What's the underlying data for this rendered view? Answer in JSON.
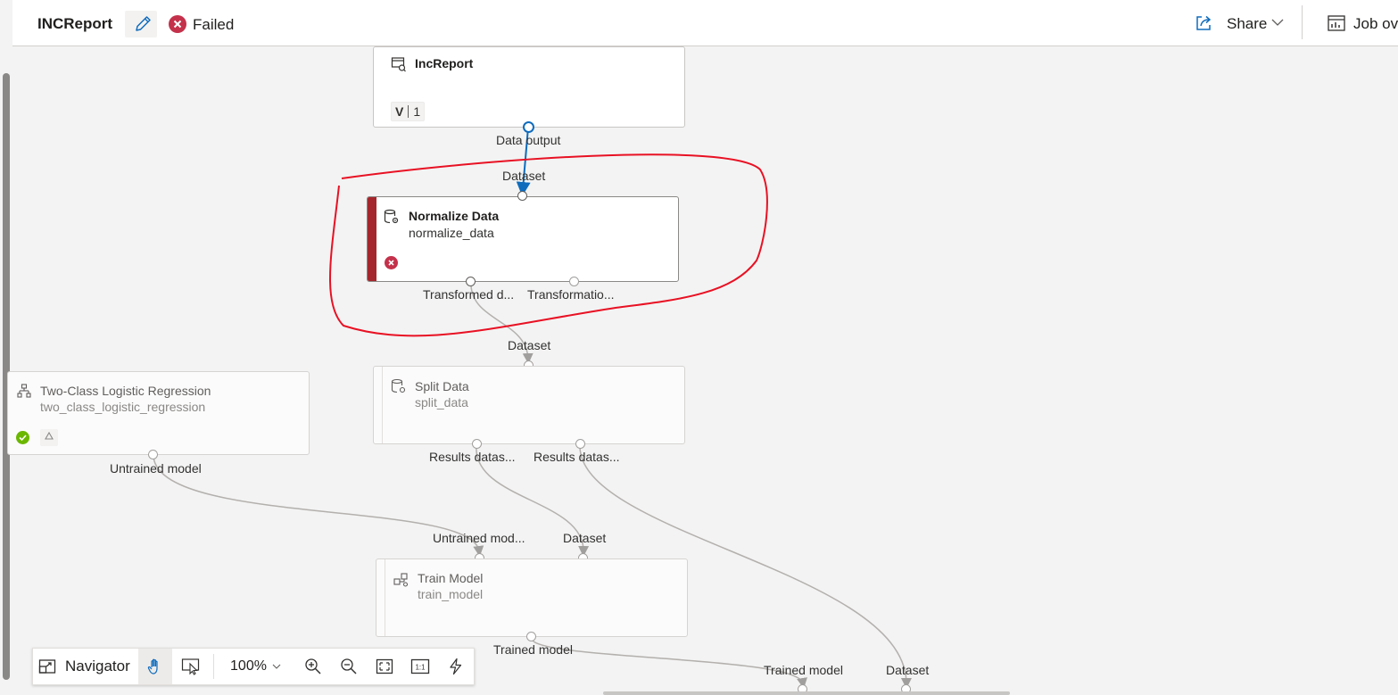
{
  "header": {
    "pipeline_name": "INCReport",
    "status": "Failed",
    "share_label": "Share",
    "job_overview_label": "Job ov"
  },
  "nodes": {
    "inc_report": {
      "title": "IncReport",
      "version_prefix": "V",
      "version": "1",
      "output": "Data output"
    },
    "normalize": {
      "input": "Dataset",
      "title": "Normalize Data",
      "subtitle": "normalize_data",
      "output1": "Transformed d...",
      "output2": "Transformatio..."
    },
    "logistic": {
      "title": "Two-Class Logistic Regression",
      "subtitle": "two_class_logistic_regression",
      "output": "Untrained model"
    },
    "split": {
      "input": "Dataset",
      "title": "Split Data",
      "subtitle": "split_data",
      "output1": "Results datas...",
      "output2": "Results datas..."
    },
    "train": {
      "input1": "Untrained mod...",
      "input2": "Dataset",
      "title": "Train Model",
      "subtitle": "train_model",
      "output": "Trained model"
    },
    "score": {
      "input1": "Trained model",
      "input2": "Dataset"
    }
  },
  "toolbar": {
    "navigator_label": "Navigator",
    "zoom_label": "100%"
  },
  "icons": {
    "edit": "pencil-icon",
    "status": "error-circle-icon",
    "share": "share-icon",
    "job": "chart-icon"
  },
  "colors": {
    "error": "#a4262c",
    "error_icon": "#c4314b",
    "success": "#6bb700",
    "accent": "#0f6cbd",
    "annotation": "#e81123"
  }
}
